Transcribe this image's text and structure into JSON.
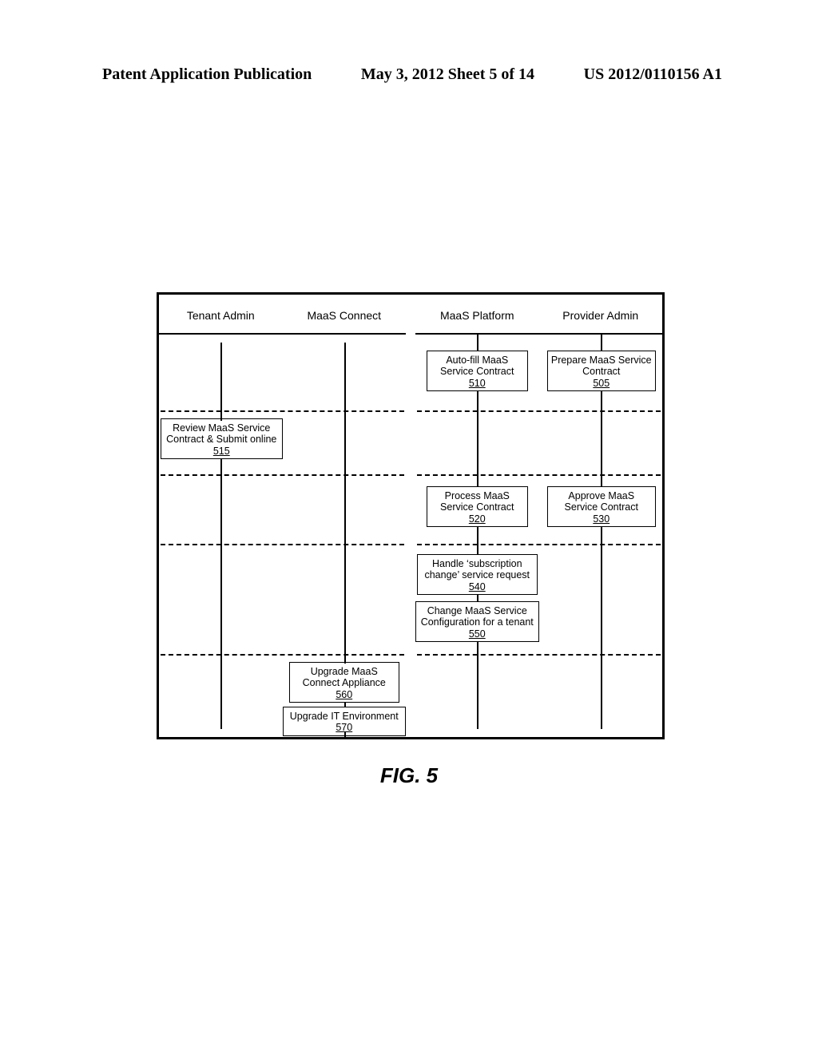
{
  "header": {
    "left": "Patent Application Publication",
    "center": "May 3, 2012   Sheet 5 of 14",
    "right": "US 2012/0110156 A1"
  },
  "lanes": {
    "tenant_admin": "Tenant Admin",
    "maas_connect": "MaaS Connect",
    "maas_platform": "MaaS Platform",
    "provider_admin": "Provider Admin"
  },
  "boxes": {
    "b505": {
      "text": "Prepare MaaS Service Contract",
      "num": "505"
    },
    "b510": {
      "text": "Auto-fill MaaS Service Contract",
      "num": "510"
    },
    "b515": {
      "text": "Review MaaS Service Contract & Submit online",
      "num": "515"
    },
    "b520": {
      "text": "Process MaaS Service Contract",
      "num": "520"
    },
    "b530": {
      "text": "Approve MaaS Service Contract",
      "num": "530"
    },
    "b540": {
      "text": "Handle ‘subscription change’ service request",
      "num": "540"
    },
    "b550": {
      "text": "Change MaaS Service Configuration for a tenant",
      "num": "550"
    },
    "b560": {
      "text": "Upgrade MaaS Connect Appliance",
      "num": "560"
    },
    "b570": {
      "text": "Upgrade IT Environment",
      "num": "570"
    }
  },
  "figure_label": "FIG. 5",
  "chart_data": {
    "type": "table",
    "description": "Swimlane flow across four roles with numbered process steps",
    "lanes": [
      "Tenant Admin",
      "MaaS Connect",
      "MaaS Platform",
      "Provider Admin"
    ],
    "rows": [
      {
        "row": 1,
        "steps": [
          {
            "lane": "MaaS Platform",
            "id": 510,
            "label": "Auto-fill MaaS Service Contract"
          },
          {
            "lane": "Provider Admin",
            "id": 505,
            "label": "Prepare MaaS Service Contract"
          }
        ]
      },
      {
        "row": 2,
        "steps": [
          {
            "lane": "Tenant Admin",
            "id": 515,
            "label": "Review MaaS Service Contract & Submit online"
          }
        ]
      },
      {
        "row": 3,
        "steps": [
          {
            "lane": "MaaS Platform",
            "id": 520,
            "label": "Process MaaS Service Contract"
          },
          {
            "lane": "Provider Admin",
            "id": 530,
            "label": "Approve MaaS Service Contract"
          }
        ]
      },
      {
        "row": 4,
        "steps": [
          {
            "lane": "MaaS Platform",
            "id": 540,
            "label": "Handle ‘subscription change’ service request"
          },
          {
            "lane": "MaaS Platform",
            "id": 550,
            "label": "Change MaaS Service Configuration for a tenant"
          }
        ]
      },
      {
        "row": 5,
        "steps": [
          {
            "lane": "MaaS Connect",
            "id": 560,
            "label": "Upgrade MaaS Connect Appliance"
          },
          {
            "lane": "MaaS Connect",
            "id": 570,
            "label": "Upgrade IT Environment"
          }
        ]
      }
    ]
  }
}
